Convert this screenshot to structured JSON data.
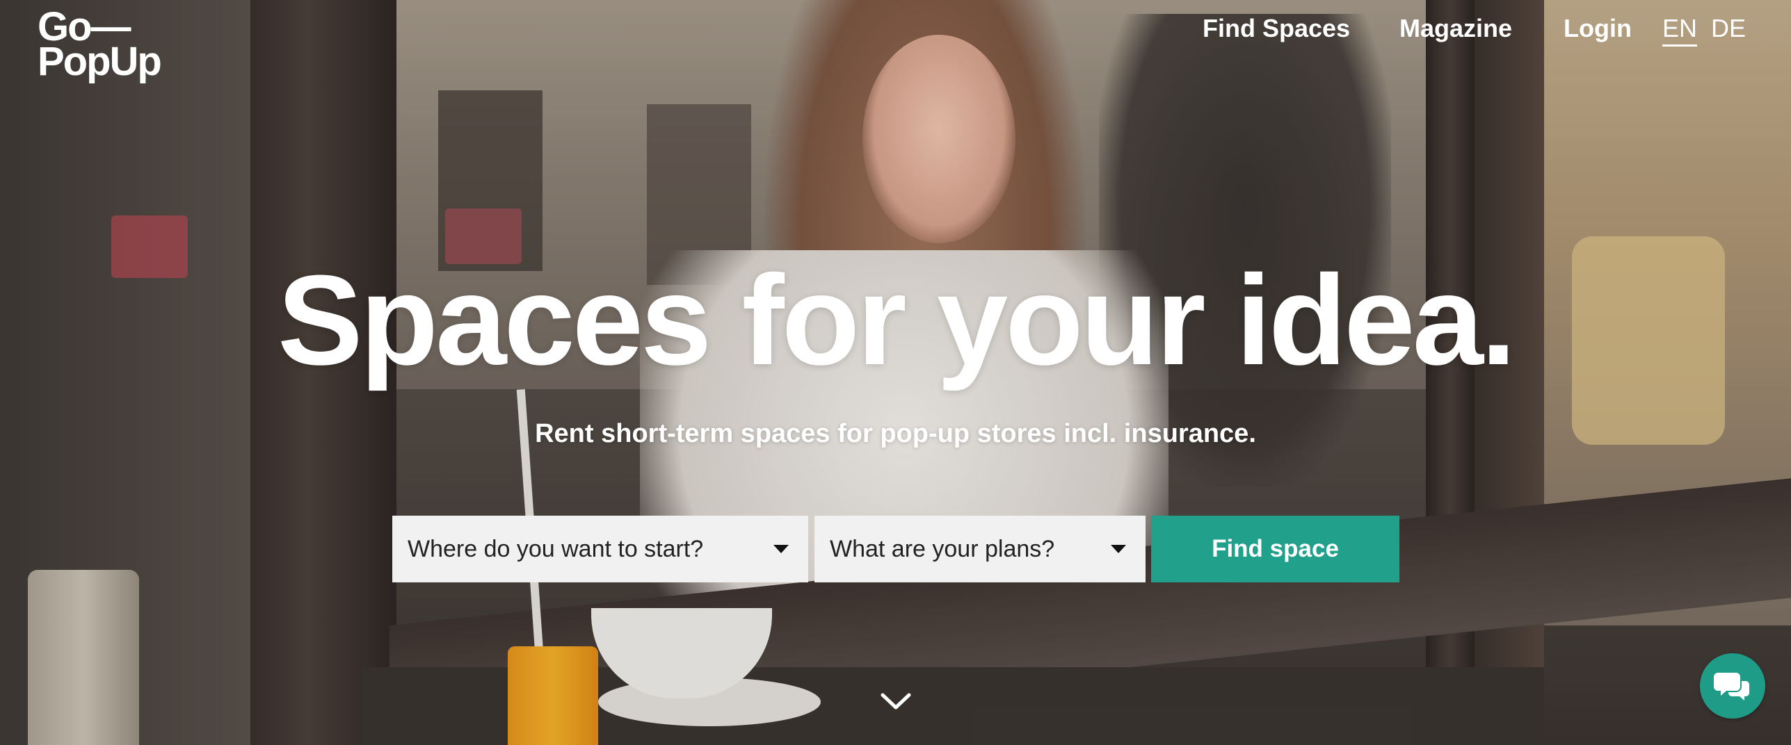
{
  "brand": {
    "logo_line1": "Go—",
    "logo_line2": "PopUp"
  },
  "nav": {
    "find_spaces": "Find Spaces",
    "magazine": "Magazine",
    "login": "Login",
    "languages": [
      {
        "code": "EN",
        "active": true
      },
      {
        "code": "DE",
        "active": false
      }
    ]
  },
  "hero": {
    "headline": "Spaces for your idea.",
    "subheadline": "Rent short-term spaces for pop-up stores incl. insurance."
  },
  "search": {
    "location_select": "Where do you want to start?",
    "plans_select": "What are your plans?",
    "submit_label": "Find space"
  },
  "icons": {
    "scroll_down": "chevron-down-icon",
    "chat": "chat-bubbles-icon"
  },
  "colors": {
    "accent": "#21a08c",
    "chat_button": "#1e9c87",
    "select_background": "#f1f1f1",
    "text_light": "#ffffff"
  }
}
